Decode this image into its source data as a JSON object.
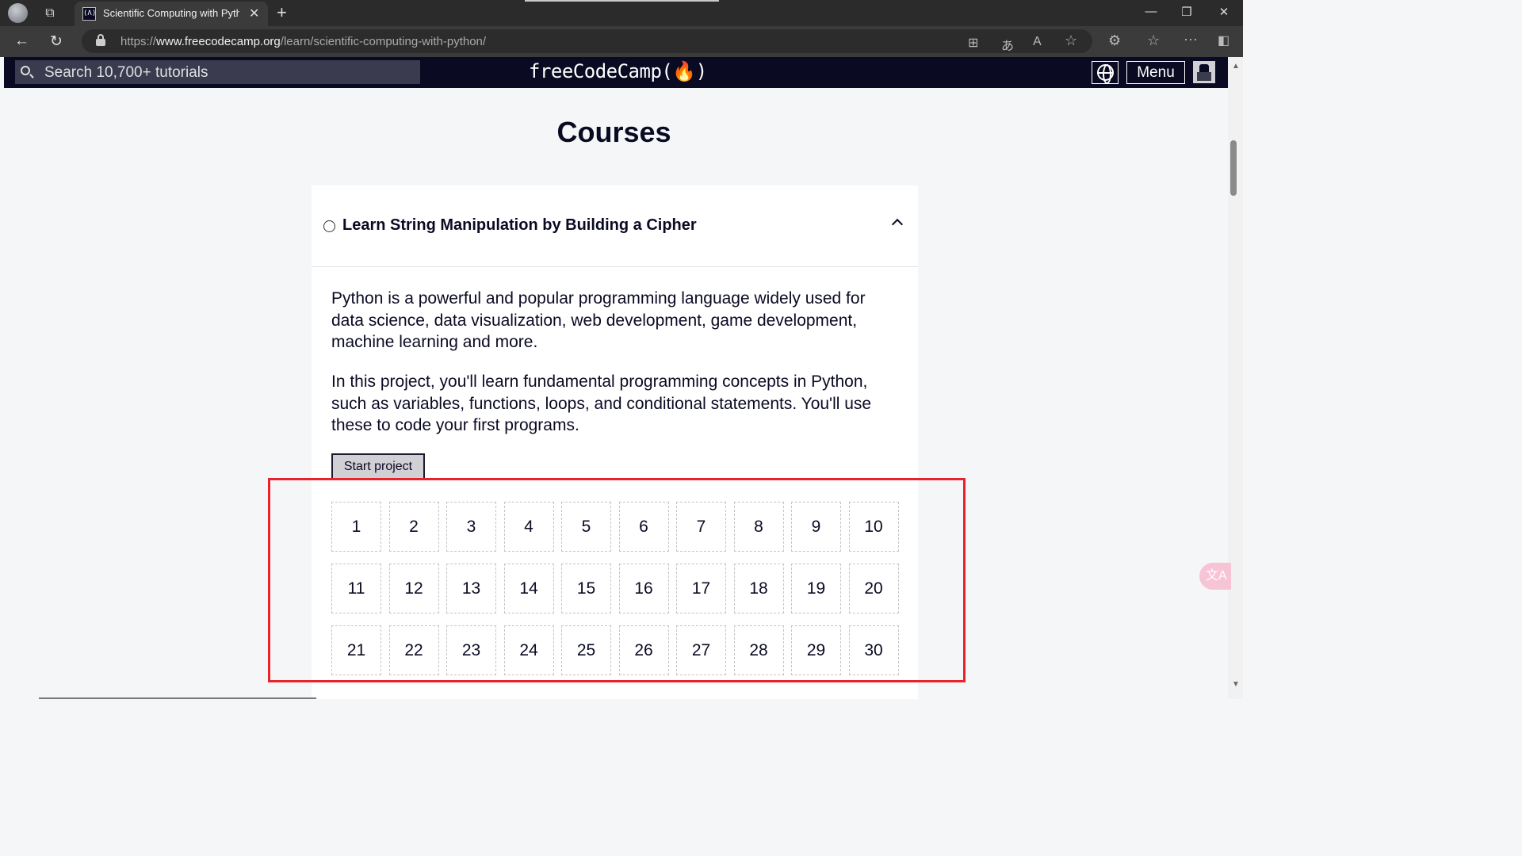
{
  "browser": {
    "tab_title": "Scientific Computing with Python",
    "tab_close": "✕",
    "new_tab": "+",
    "url_prefix": "https://",
    "url_domain": "www.freecodecamp.org",
    "url_path": "/learn/scientific-computing-with-python/"
  },
  "nav": {
    "search_placeholder": "Search 10,700+ tutorials",
    "logo": "freeCodeCamp(🔥)",
    "menu_label": "Menu"
  },
  "page": {
    "heading": "Courses"
  },
  "course": {
    "title": "Learn String Manipulation by Building a Cipher",
    "description_1": "Python is a powerful and popular programming language widely used for data science, data visualization, web development, game development, machine learning and more.",
    "description_2": "In this project, you'll learn fundamental programming concepts in Python, such as variables, functions, loops, and conditional statements. You'll use these to code your first programs.",
    "start_label": "Start project",
    "steps": [
      "1",
      "2",
      "3",
      "4",
      "5",
      "6",
      "7",
      "8",
      "9",
      "10",
      "11",
      "12",
      "13",
      "14",
      "15",
      "16",
      "17",
      "18",
      "19",
      "20",
      "21",
      "22",
      "23",
      "24",
      "25",
      "26",
      "27",
      "28",
      "29",
      "30"
    ]
  },
  "colors": {
    "nav_bg": "#0a0a23",
    "highlight": "#e8232b",
    "button_bg": "#d0d0d5"
  }
}
